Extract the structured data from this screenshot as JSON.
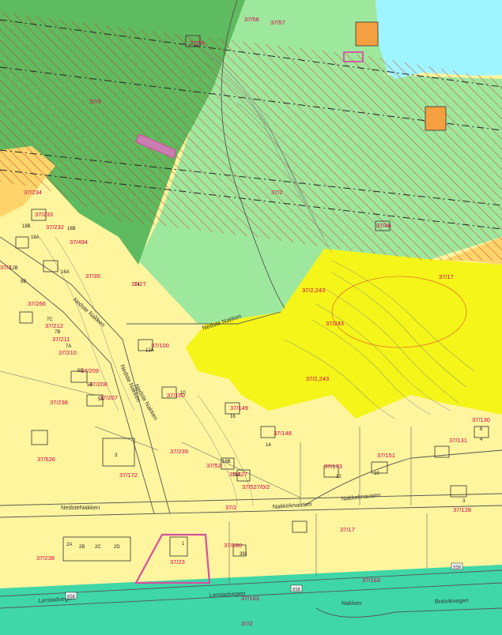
{
  "colors": {
    "water": "#9ff5ff",
    "light_green": "#9ee89e",
    "dark_green": "#5fbb5f",
    "mid_green": "#7fd38a",
    "residential": "#fff59e",
    "orange_zone": "#ffd56b",
    "bright_yellow": "#f5f51a",
    "road_band": "#3fd7a7",
    "hatch_red": "#d93020",
    "highlight_pink": "#d94fa0",
    "label_red": "#d6004a"
  },
  "parcels": [
    "37/56",
    "37/57",
    "37/55",
    "37/3",
    "37/234",
    "37/233",
    "37/232",
    "37/494",
    "37/1",
    "37/35",
    "37/27",
    "37/2",
    "37/46",
    "37/17",
    "37/2,243",
    "37/243",
    "37/266",
    "37/212",
    "37/211",
    "37/210",
    "37/209",
    "37/208",
    "37/207",
    "37/238",
    "37/100",
    "37/150",
    "37/149",
    "37/148",
    "37/2,243",
    "37/239",
    "37/131",
    "37/130",
    "37/173",
    "37/151",
    "37/526",
    "37/172",
    "37/52",
    "37/227",
    "37/527/0/2",
    "37/128",
    "37/2",
    "37/590",
    "37/17",
    "37/238",
    "37/23",
    "37/163",
    "37/163",
    "37/2"
  ],
  "house_numbers": [
    "12B",
    "18B",
    "16B",
    "18A",
    "16A",
    "14",
    "9B",
    "7C",
    "7B",
    "7A",
    "5C",
    "5B",
    "5A",
    "12A",
    "10",
    "16",
    "14",
    "2B",
    "2A",
    "2C",
    "2D",
    "1",
    "3",
    "391",
    "16B",
    "16A",
    "12",
    "10",
    "6",
    "4",
    "3"
  ],
  "roads": [
    "Nedste Nakken",
    "Nedste Nakken",
    "Nedste Nakken",
    "NedsteNakken",
    "Nakkeknausen",
    "Nakkeknausen",
    "Lerstadvegen",
    "Lerstadvegen",
    "Nakken",
    "Breivikvegen",
    "Nedste Nakken"
  ],
  "road_numbers": [
    "558",
    "658",
    "658"
  ]
}
